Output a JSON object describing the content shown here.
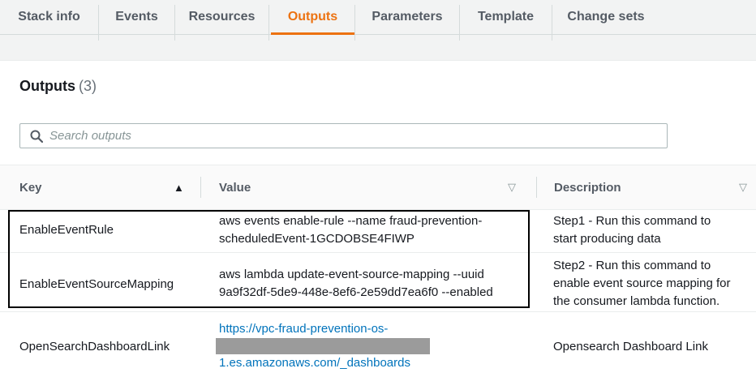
{
  "tabs": [
    {
      "label": "Stack info",
      "active": false
    },
    {
      "label": "Events",
      "active": false
    },
    {
      "label": "Resources",
      "active": false
    },
    {
      "label": "Outputs",
      "active": true
    },
    {
      "label": "Parameters",
      "active": false
    },
    {
      "label": "Template",
      "active": false
    },
    {
      "label": "Change sets",
      "active": false
    }
  ],
  "panel": {
    "title": "Outputs",
    "count": "(3)"
  },
  "search": {
    "placeholder": "Search outputs",
    "value": ""
  },
  "table": {
    "columns": [
      {
        "label": "Key",
        "sort": "ascending"
      },
      {
        "label": "Value",
        "sort": "none"
      },
      {
        "label": "Description",
        "sort": "none"
      }
    ],
    "rows": [
      {
        "key": "EnableEventRule",
        "value_lines": [
          "aws events enable-rule --name fraud-prevention-",
          "scheduledEvent-1GCDOBSE4FIWP"
        ],
        "description_lines": [
          "Step1 - Run this command to",
          "start producing data"
        ]
      },
      {
        "key": "EnableEventSourceMapping",
        "value_lines": [
          "aws lambda update-event-source-mapping --uuid",
          "9a9f32df-5de9-448e-8ef6-2e59dd7ea6f0 --enabled"
        ],
        "description_lines": [
          "Step2 - Run this command to",
          "enable event source mapping for",
          "the consumer lambda function."
        ]
      },
      {
        "key": "OpenSearchDashboardLink",
        "value_lines": [
          "https://vpc-fraud-prevention-os-",
          "1.es.amazonaws.com/_dashboards"
        ],
        "value_redacted": true,
        "description_lines": [
          "Opensearch Dashboard Link"
        ]
      }
    ]
  },
  "icons": {
    "search": "search-icon",
    "sort": "sort-ascending-icon",
    "filter": "filter-dropdown-icon"
  },
  "colors": {
    "accent": "#ec7211",
    "link": "#0073bb"
  }
}
